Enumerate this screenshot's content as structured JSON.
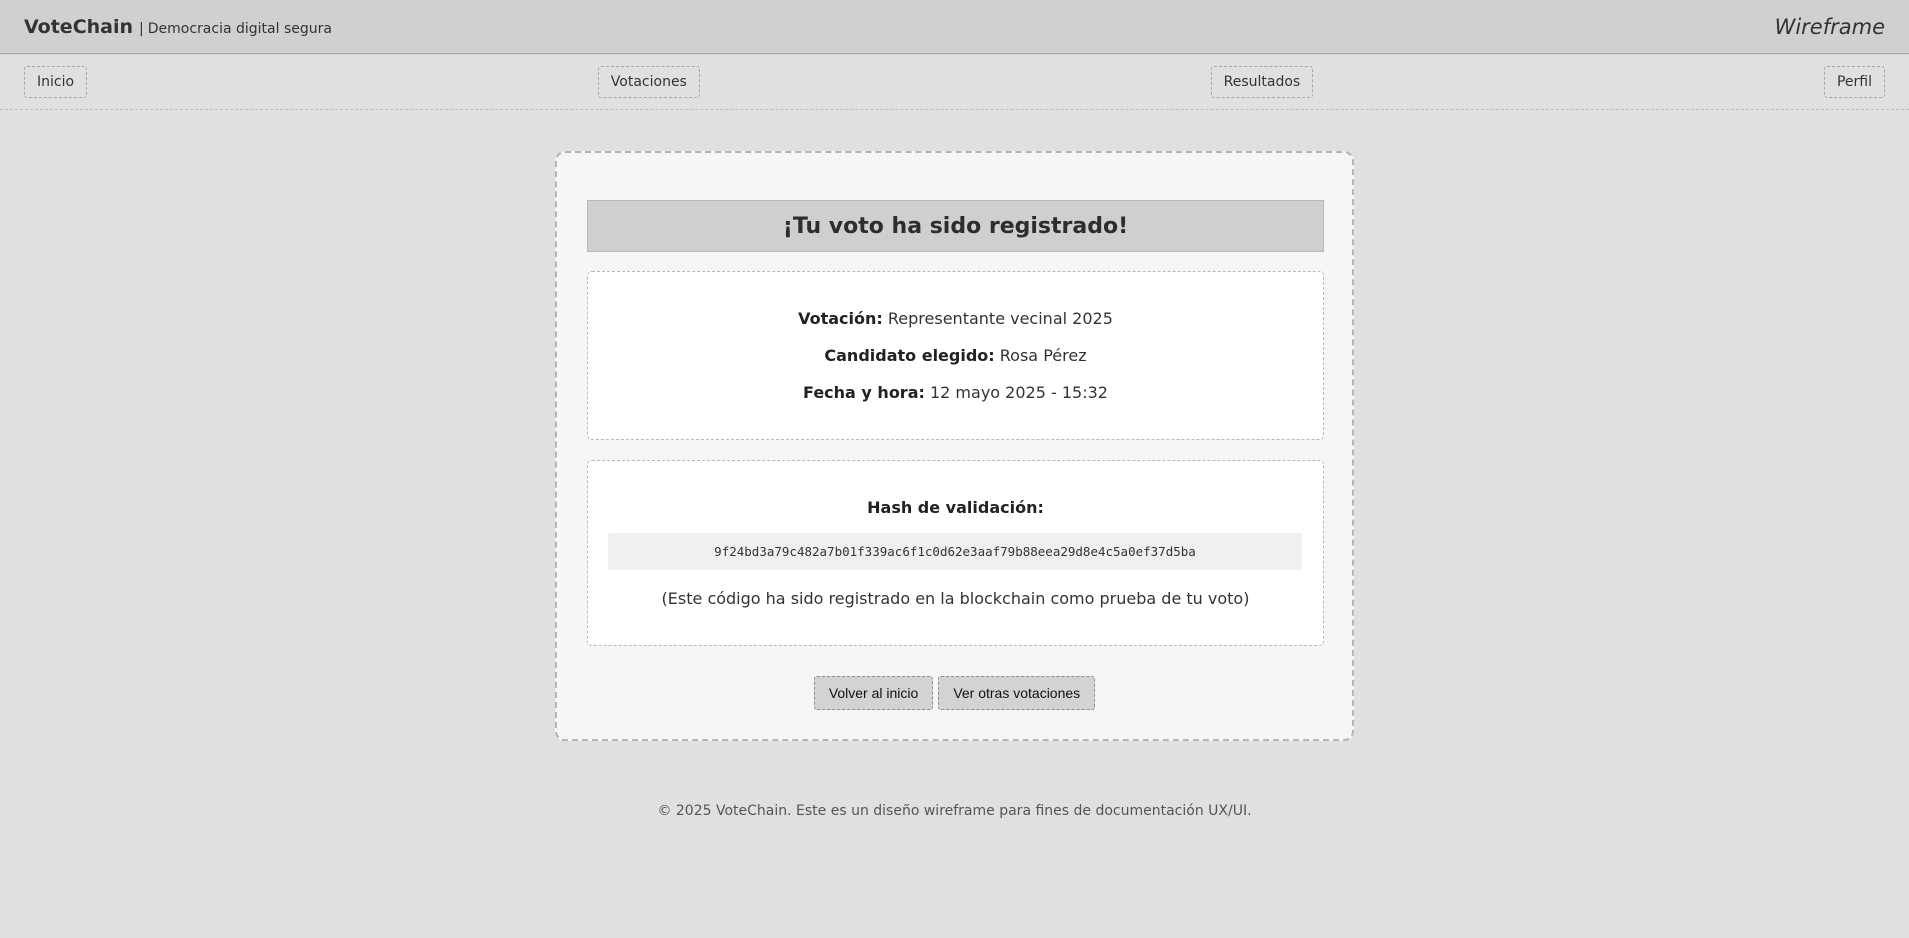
{
  "header": {
    "brand": "VoteChain",
    "separator": "|",
    "tagline": "Democracia digital segura",
    "label": "Wireframe"
  },
  "nav": {
    "items": [
      "Inicio",
      "Votaciones",
      "Resultados",
      "Perfil"
    ]
  },
  "confirmation": {
    "title": "¡Tu voto ha sido registrado!",
    "details": [
      {
        "label": "Votación:",
        "value": "Representante vecinal 2025"
      },
      {
        "label": "Candidato elegido:",
        "value": "Rosa Pérez"
      },
      {
        "label": "Fecha y hora:",
        "value": "12 mayo 2025 - 15:32"
      }
    ],
    "hash": {
      "title": "Hash de validación:",
      "value": "9f24bd3a79c482a7b01f339ac6f1c0d62e3aaf79b88eea29d8e4c5a0ef37d5ba",
      "note": "(Este código ha sido registrado en la blockchain como prueba de tu voto)"
    },
    "actions": {
      "home": "Volver al inicio",
      "other": "Ver otras votaciones"
    }
  },
  "footer": {
    "text": "© 2025 VoteChain. Este es un diseño wireframe para fines de documentación UX/UI."
  },
  "colors": {
    "header_bg": "#d0d0d0",
    "page_bg": "#e0e0e0",
    "card_bg": "#f6f6f6",
    "title_bar_bg": "#cfcfcf",
    "hash_box_bg": "#efefef",
    "button_bg": "#d3d3d3"
  }
}
